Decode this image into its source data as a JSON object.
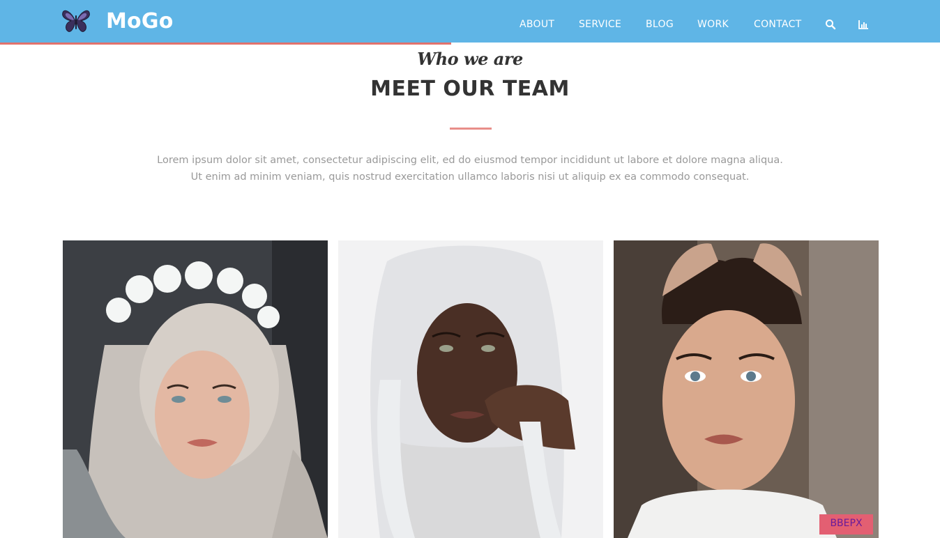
{
  "brand": {
    "name": "MoGo",
    "logo_icon": "butterfly-icon"
  },
  "nav": {
    "items": [
      {
        "label": "ABOUT"
      },
      {
        "label": "SERVICE"
      },
      {
        "label": "BLOG"
      },
      {
        "label": "WORK"
      },
      {
        "label": "CONTACT"
      }
    ],
    "icons": [
      "search-icon",
      "bar-chart-icon"
    ]
  },
  "colors": {
    "header": "#5fb5e6",
    "accent": "#e2726c",
    "heading": "#333333",
    "text_muted": "#999999",
    "top_button": "#e35f72"
  },
  "scroll_progress": 0.48,
  "section": {
    "subtitle": "Who we are",
    "title": "MEET OUR TEAM",
    "lead_line1": "Lorem ipsum dolor sit amet, consectetur adipiscing elit, ed do eiusmod tempor incididunt ut labore et dolore magna aliqua.",
    "lead_line2": "Ut enim ad minim veniam, quis nostrud exercitation ullamco laboris nisi ut aliquip ex ea commodo consequat."
  },
  "team": [
    {
      "photo": "team-photo-1"
    },
    {
      "photo": "team-photo-2"
    },
    {
      "photo": "team-photo-3"
    }
  ],
  "scroll_top_button": {
    "label": "ВВЕРХ"
  }
}
